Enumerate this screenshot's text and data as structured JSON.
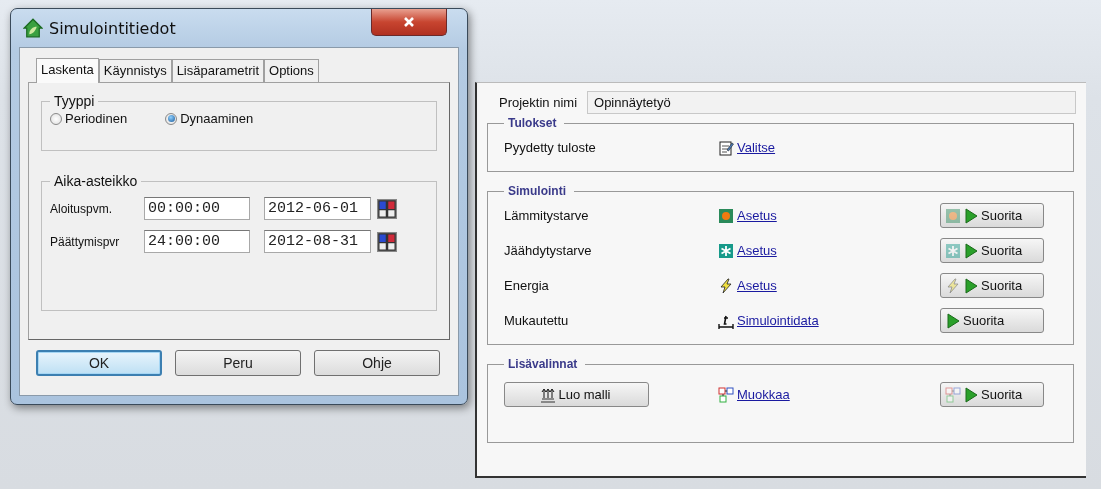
{
  "dialog": {
    "title": "Simulointitiedot",
    "tabs": [
      {
        "label": "Laskenta",
        "selected": true
      },
      {
        "label": "Käynnistys",
        "selected": false
      },
      {
        "label": "Lisäparametrit",
        "selected": false
      },
      {
        "label": "Options",
        "selected": false
      }
    ],
    "type_group": {
      "legend": "Tyyppi",
      "options": [
        {
          "label": "Periodinen",
          "selected": false
        },
        {
          "label": "Dynaaminen",
          "selected": true
        }
      ]
    },
    "time_group": {
      "legend": "Aika-asteikko",
      "rows": [
        {
          "label": "Aloituspvm.",
          "time": "00:00:00",
          "date": "2012-06-01"
        },
        {
          "label": "Päättymispvr",
          "time": "24:00:00",
          "date": "2012-08-31"
        }
      ]
    },
    "buttons": [
      {
        "label": "OK",
        "default": true
      },
      {
        "label": "Peru",
        "default": false
      },
      {
        "label": "Ohje",
        "default": false
      }
    ]
  },
  "project": {
    "name_label": "Projektin nimi",
    "name_value": "Opinnäytetyö",
    "sections": [
      {
        "title": "Tulokset",
        "rows": [
          {
            "kind": "text",
            "label": "Pyydetty tuloste",
            "link": "Valitse"
          }
        ]
      },
      {
        "title": "Simulointi",
        "rows": [
          {
            "kind": "text",
            "label": "Lämmitystarve",
            "link": "Asetus",
            "run": "Suorita"
          },
          {
            "kind": "text",
            "label": "Jäähdytystarve",
            "link": "Asetus",
            "run": "Suorita"
          },
          {
            "kind": "text",
            "label": "Energia",
            "link": "Asetus",
            "run": "Suorita"
          },
          {
            "kind": "text",
            "label": "Mukautettu",
            "link": "Simulointidata",
            "run": "Suorita"
          }
        ]
      },
      {
        "title": "Lisävalinnat",
        "rows": [
          {
            "kind": "button",
            "label": "Luo malli",
            "link": "Muokkaa",
            "run": "Suorita"
          }
        ]
      }
    ]
  }
}
